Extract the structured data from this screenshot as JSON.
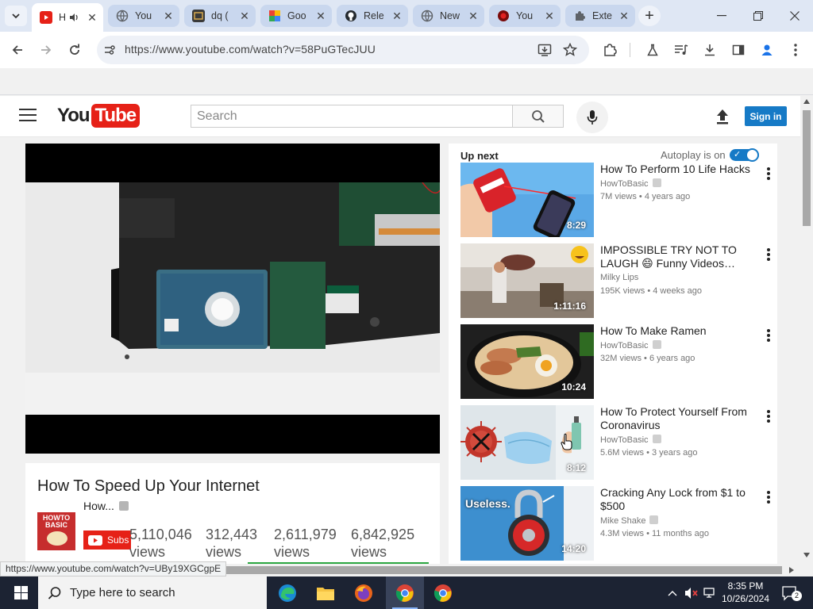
{
  "browser": {
    "tabs": [
      {
        "title": "H",
        "active": true,
        "favicon": "youtube-icon"
      },
      {
        "title": "You",
        "active": false,
        "favicon": "globe-icon"
      },
      {
        "title": "dq (",
        "active": false,
        "favicon": "app-icon"
      },
      {
        "title": "Goo",
        "active": false,
        "favicon": "google-icon"
      },
      {
        "title": "Rele",
        "active": false,
        "favicon": "github-icon"
      },
      {
        "title": "New",
        "active": false,
        "favicon": "globe-icon"
      },
      {
        "title": "You",
        "active": false,
        "favicon": "red-circle-icon"
      },
      {
        "title": "Exte",
        "active": false,
        "favicon": "puzzle-icon"
      }
    ],
    "url": "https://www.youtube.com/watch?v=58PuGTecJUU",
    "status_url": "https://www.youtube.com/watch?v=UBy19XGCgpE"
  },
  "youtube": {
    "search_placeholder": "Search",
    "signin_label": "Sign in",
    "logo_you": "You",
    "logo_tube": "Tube"
  },
  "video": {
    "title": "How To Speed Up Your Internet",
    "channel": "How...",
    "channel_thumb_text": "HOWTO BASIC",
    "subscribe_label": "Subs",
    "stats": [
      "5,110,046 views",
      "312,443 views",
      "2,611,979 views",
      "6,842,925 views"
    ]
  },
  "sidebar": {
    "up_next": "Up next",
    "autoplay": "Autoplay is on",
    "autoplay_on": true,
    "videos": [
      {
        "title": "How To Perform 10 Life Hacks",
        "channel": "HowToBasic",
        "views": "7M views",
        "age": "4 years ago",
        "duration": "8:29"
      },
      {
        "title": "IMPOSSIBLE TRY NOT TO LAUGH 😄 Funny Videos…",
        "channel": "Milky Lips",
        "views": "195K views",
        "age": "4 weeks ago",
        "duration": "1:11:16"
      },
      {
        "title": "How To Make Ramen",
        "channel": "HowToBasic",
        "views": "32M views",
        "age": "6 years ago",
        "duration": "10:24"
      },
      {
        "title": "How To Protect Yourself From Coronavirus",
        "channel": "HowToBasic",
        "views": "5.6M views",
        "age": "3 years ago",
        "duration": "8:12"
      },
      {
        "title": "Cracking Any Lock from $1 to $500",
        "channel": "Mike Shake",
        "views": "4.3M views",
        "age": "11 months ago",
        "duration": "14:20",
        "thumb_text": "Useless."
      }
    ]
  },
  "taskbar": {
    "search_placeholder": "Type here to search",
    "time": "8:35 PM",
    "date": "10/26/2024",
    "notification_count": "2"
  },
  "colors": {
    "youtube_red": "#e62117",
    "youtube_blue": "#167ac6",
    "chrome_tabstrip": "#dfe7f4",
    "taskbar": "#1c2333"
  }
}
